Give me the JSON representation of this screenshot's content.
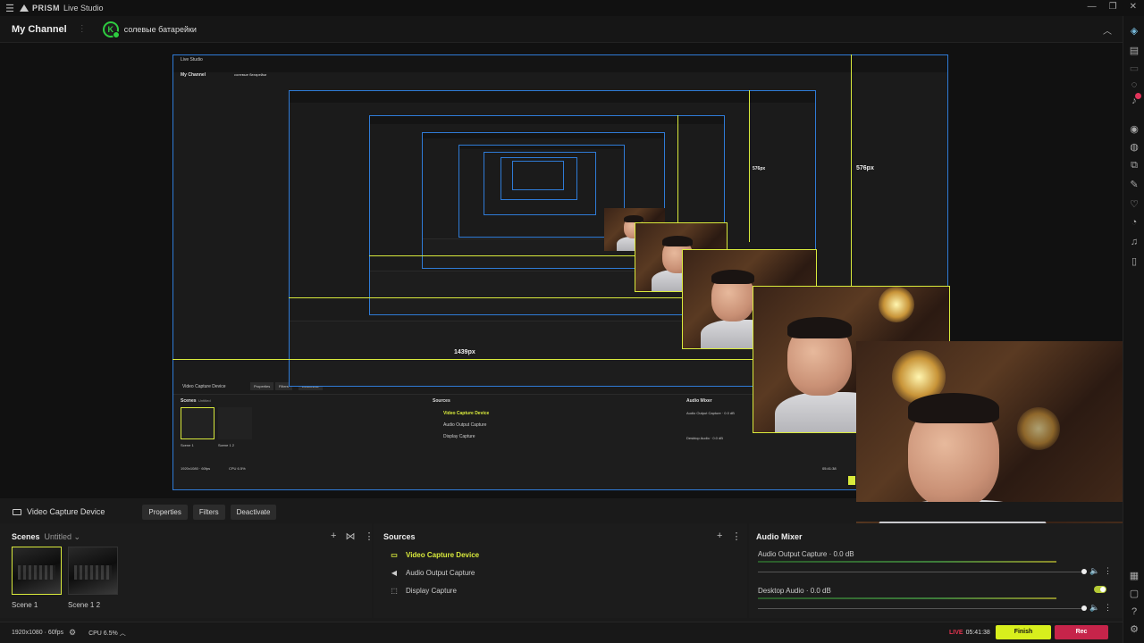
{
  "app": {
    "brand": "PRISM",
    "name": "Live Studio"
  },
  "channel": {
    "title": "My Channel",
    "account": "солевые батарейки"
  },
  "preview": {
    "dim_label_1": "576px",
    "dim_label_2": "576px",
    "dim_label_3": "1439px",
    "inner_channel": "My Channel",
    "inner_account": "солевые батарейки",
    "inner_source": "Video Capture Device",
    "inner_properties": "Properties",
    "inner_filters": "Filters",
    "inner_deactivate": "Deactivate",
    "inner_scenes": "Scenes",
    "inner_untitled": "Untitled",
    "inner_scene1": "Scene 1",
    "inner_scene2": "Scene 1 2",
    "inner_sources": "Sources",
    "inner_src1": "Video Capture Device",
    "inner_src2": "Audio Output Capture",
    "inner_src3": "Display Capture",
    "inner_mixer": "Audio Mixer",
    "inner_mix1": "Audio Output Capture · 0.0 dB",
    "inner_mix2": "Desktop Audio · 0.0 dB",
    "inner_res": "1920x1080 · 60fps",
    "inner_cpu": "CPU 6.5%",
    "inner_time": "05:41:38"
  },
  "toolbar": {
    "source": "Video Capture Device",
    "properties": "Properties",
    "filters": "Filters",
    "deactivate": "Deactivate"
  },
  "scenes": {
    "title": "Scenes",
    "subtitle": "Untitled",
    "items": [
      {
        "label": "Scene 1"
      },
      {
        "label": "Scene 1 2"
      }
    ]
  },
  "sources": {
    "title": "Sources",
    "items": [
      {
        "label": "Video Capture Device",
        "icon": "camera-icon"
      },
      {
        "label": "Audio Output Capture",
        "icon": "speaker-icon"
      },
      {
        "label": "Display Capture",
        "icon": "display-capture-icon"
      }
    ]
  },
  "mixer": {
    "title": "Audio Mixer",
    "channels": [
      {
        "label": "Audio Output Capture · 0.0 dB",
        "level": 0.95
      },
      {
        "label": "Desktop Audio · 0.0 dB",
        "level": 0.95
      }
    ]
  },
  "status": {
    "resolution": "1920x1080 · 60fps",
    "cpu": "CPU 6.5%",
    "live": "LIVE",
    "time": "05:41:38",
    "finish": "Finish",
    "rec": "Rec"
  },
  "colors": {
    "accent": "#d9ea3c",
    "live": "#e3344f",
    "rec": "#c6244a",
    "finish": "#d8ef1d",
    "selection": "#2f7bd6"
  }
}
